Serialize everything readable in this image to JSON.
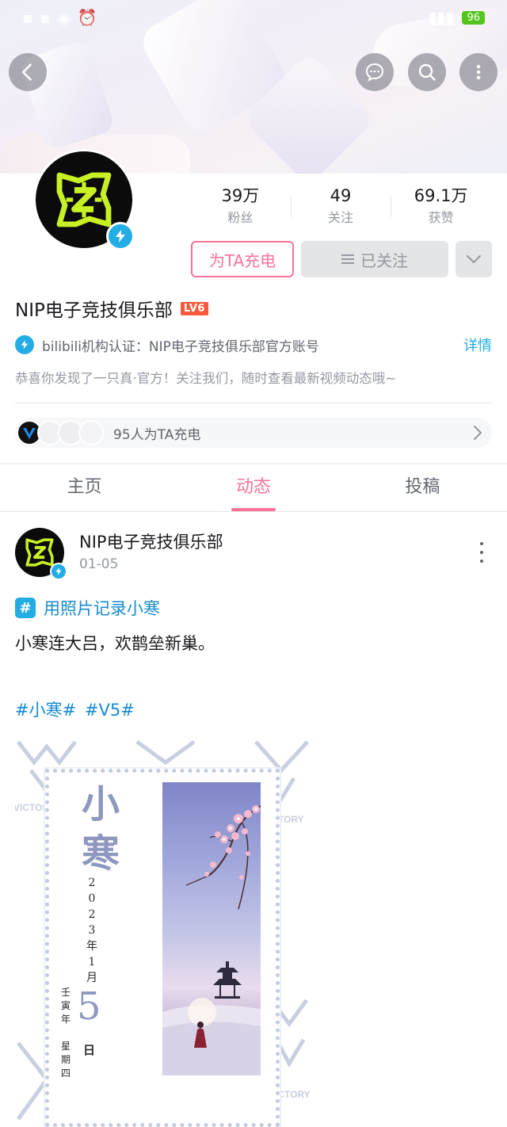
{
  "banner": {
    "back_icon": "chevron-left-icon",
    "message_icon": "chat-bubble-icon",
    "search_icon": "search-icon",
    "more_icon": "more-vertical-icon"
  },
  "status_bar": {
    "battery": "96"
  },
  "profile": {
    "stats": [
      {
        "value": "39万",
        "label": "粉丝"
      },
      {
        "value": "49",
        "label": "关注"
      },
      {
        "value": "69.1万",
        "label": "获赞"
      }
    ],
    "charge_button": "为TA充电",
    "followed_button": "已关注",
    "name": "NIP电子竞技俱乐部",
    "level_badge": "LV6",
    "certification": "bilibili机构认证：NIP电子竞技俱乐部官方账号",
    "certification_detail": "详情",
    "bio": "恭喜你发现了一只真·官方！关注我们，随时查看最新视频动态哦~",
    "charge_count_text": "95人为TA充电"
  },
  "tabs": [
    {
      "label": "主页",
      "active": false
    },
    {
      "label": "动态",
      "active": true
    },
    {
      "label": "投稿",
      "active": false
    }
  ],
  "post": {
    "author": "NIP电子竞技俱乐部",
    "date": "01-05",
    "topic": "用照片记录小寒",
    "text": "小寒连大吕，欢鹊垒新巢。",
    "tags": "#小寒# #V5#",
    "image": {
      "title_chars": [
        "小",
        "寒"
      ],
      "date_chars": [
        "2",
        "0",
        "2",
        "3",
        "年",
        "1",
        "月"
      ],
      "year_chars": [
        "壬",
        "寅",
        "年"
      ],
      "day": "5",
      "day_suffix": "日",
      "week_chars": [
        "星",
        "期",
        "四"
      ],
      "watermark_text": "VICTORY"
    }
  },
  "colors": {
    "accent_pink": "#fb7299",
    "accent_blue": "#23ade5",
    "link_blue": "#178bcf",
    "nip_lime": "#c8f025"
  }
}
